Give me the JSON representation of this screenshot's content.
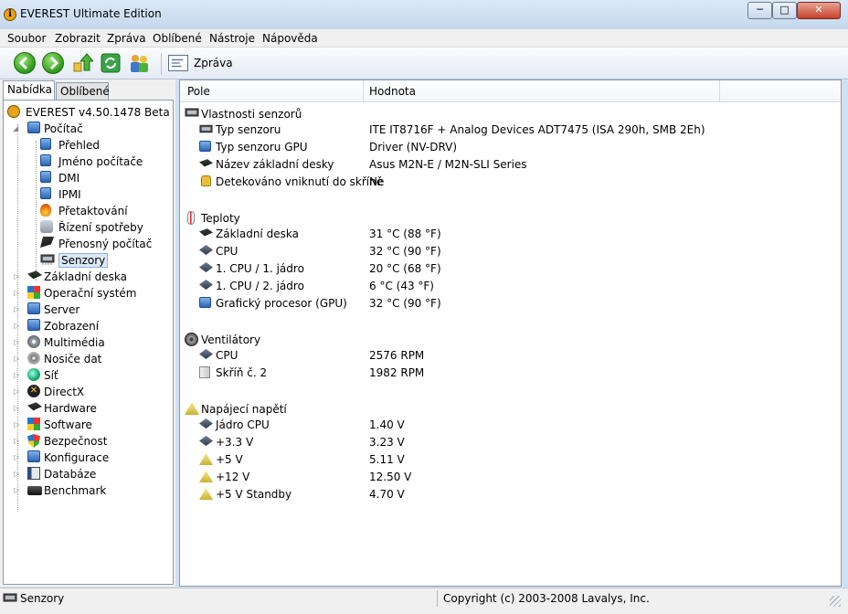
{
  "window": {
    "title": "EVEREST Ultimate Edition",
    "controls": {
      "minimize": "─",
      "maximize": "□",
      "close": "✕"
    }
  },
  "menu": [
    "Soubor",
    "Zobrazit",
    "Zpráva",
    "Oblíbené",
    "Nástroje",
    "Nápověda"
  ],
  "toolbar": {
    "report_label": "Zpráva",
    "buttons": [
      "back-icon",
      "forward-icon",
      "up-icon",
      "refresh-icon",
      "users-icon"
    ]
  },
  "left_tabs": {
    "active": "Nabídka",
    "inactive": "Oblíbené"
  },
  "tree": {
    "root": "EVEREST v4.50.1478 Beta",
    "computer": "Počítač",
    "computer_children": [
      "Přehled",
      "Jméno počítače",
      "DMI",
      "IPMI",
      "Přetaktování",
      "Řízení spotřeby",
      "Přenosný počítač",
      "Senzory"
    ],
    "selected": "Senzory",
    "categories": [
      "Základní deska",
      "Operační systém",
      "Server",
      "Zobrazení",
      "Multimédia",
      "Nosiče dat",
      "Síť",
      "DirectX",
      "Hardware",
      "Software",
      "Bezpečnost",
      "Konfigurace",
      "Databáze",
      "Benchmark"
    ]
  },
  "columns": {
    "field": "Pole",
    "value": "Hodnota"
  },
  "sections": [
    {
      "title": "Vlastnosti senzorů",
      "rows": [
        {
          "field": "Typ senzoru",
          "value": "ITE IT8716F + Analog Devices ADT7475  (ISA 290h, SMB 2Eh)"
        },
        {
          "field": "Typ senzoru GPU",
          "value": "Driver  (NV-DRV)"
        },
        {
          "field": "Název základní desky",
          "value": "Asus M2N-E / M2N-SLI Series"
        },
        {
          "field": "Detekováno vniknutí do skříně",
          "value": "Ne"
        }
      ]
    },
    {
      "title": "Teploty",
      "rows": [
        {
          "field": "Základní deska",
          "value": "31 °C  (88 °F)"
        },
        {
          "field": "CPU",
          "value": "32 °C  (90 °F)"
        },
        {
          "field": "1. CPU / 1. jádro",
          "value": "20 °C  (68 °F)"
        },
        {
          "field": "1. CPU / 2. jádro",
          "value": "6 °C  (43 °F)"
        },
        {
          "field": "Grafický procesor (GPU)",
          "value": "32 °C  (90 °F)"
        }
      ]
    },
    {
      "title": "Ventilátory",
      "rows": [
        {
          "field": "CPU",
          "value": "2576 RPM"
        },
        {
          "field": "Skříň č. 2",
          "value": "1982 RPM"
        }
      ]
    },
    {
      "title": "Napájecí napětí",
      "rows": [
        {
          "field": "Jádro CPU",
          "value": "1.40 V"
        },
        {
          "field": "+3.3 V",
          "value": "3.23 V"
        },
        {
          "field": "+5 V",
          "value": "5.11 V"
        },
        {
          "field": "+12 V",
          "value": "12.50 V"
        },
        {
          "field": "+5 V Standby",
          "value": "4.70 V"
        }
      ]
    }
  ],
  "status": {
    "left": "Senzory",
    "right": "Copyright (c) 2003-2008 Lavalys, Inc."
  }
}
